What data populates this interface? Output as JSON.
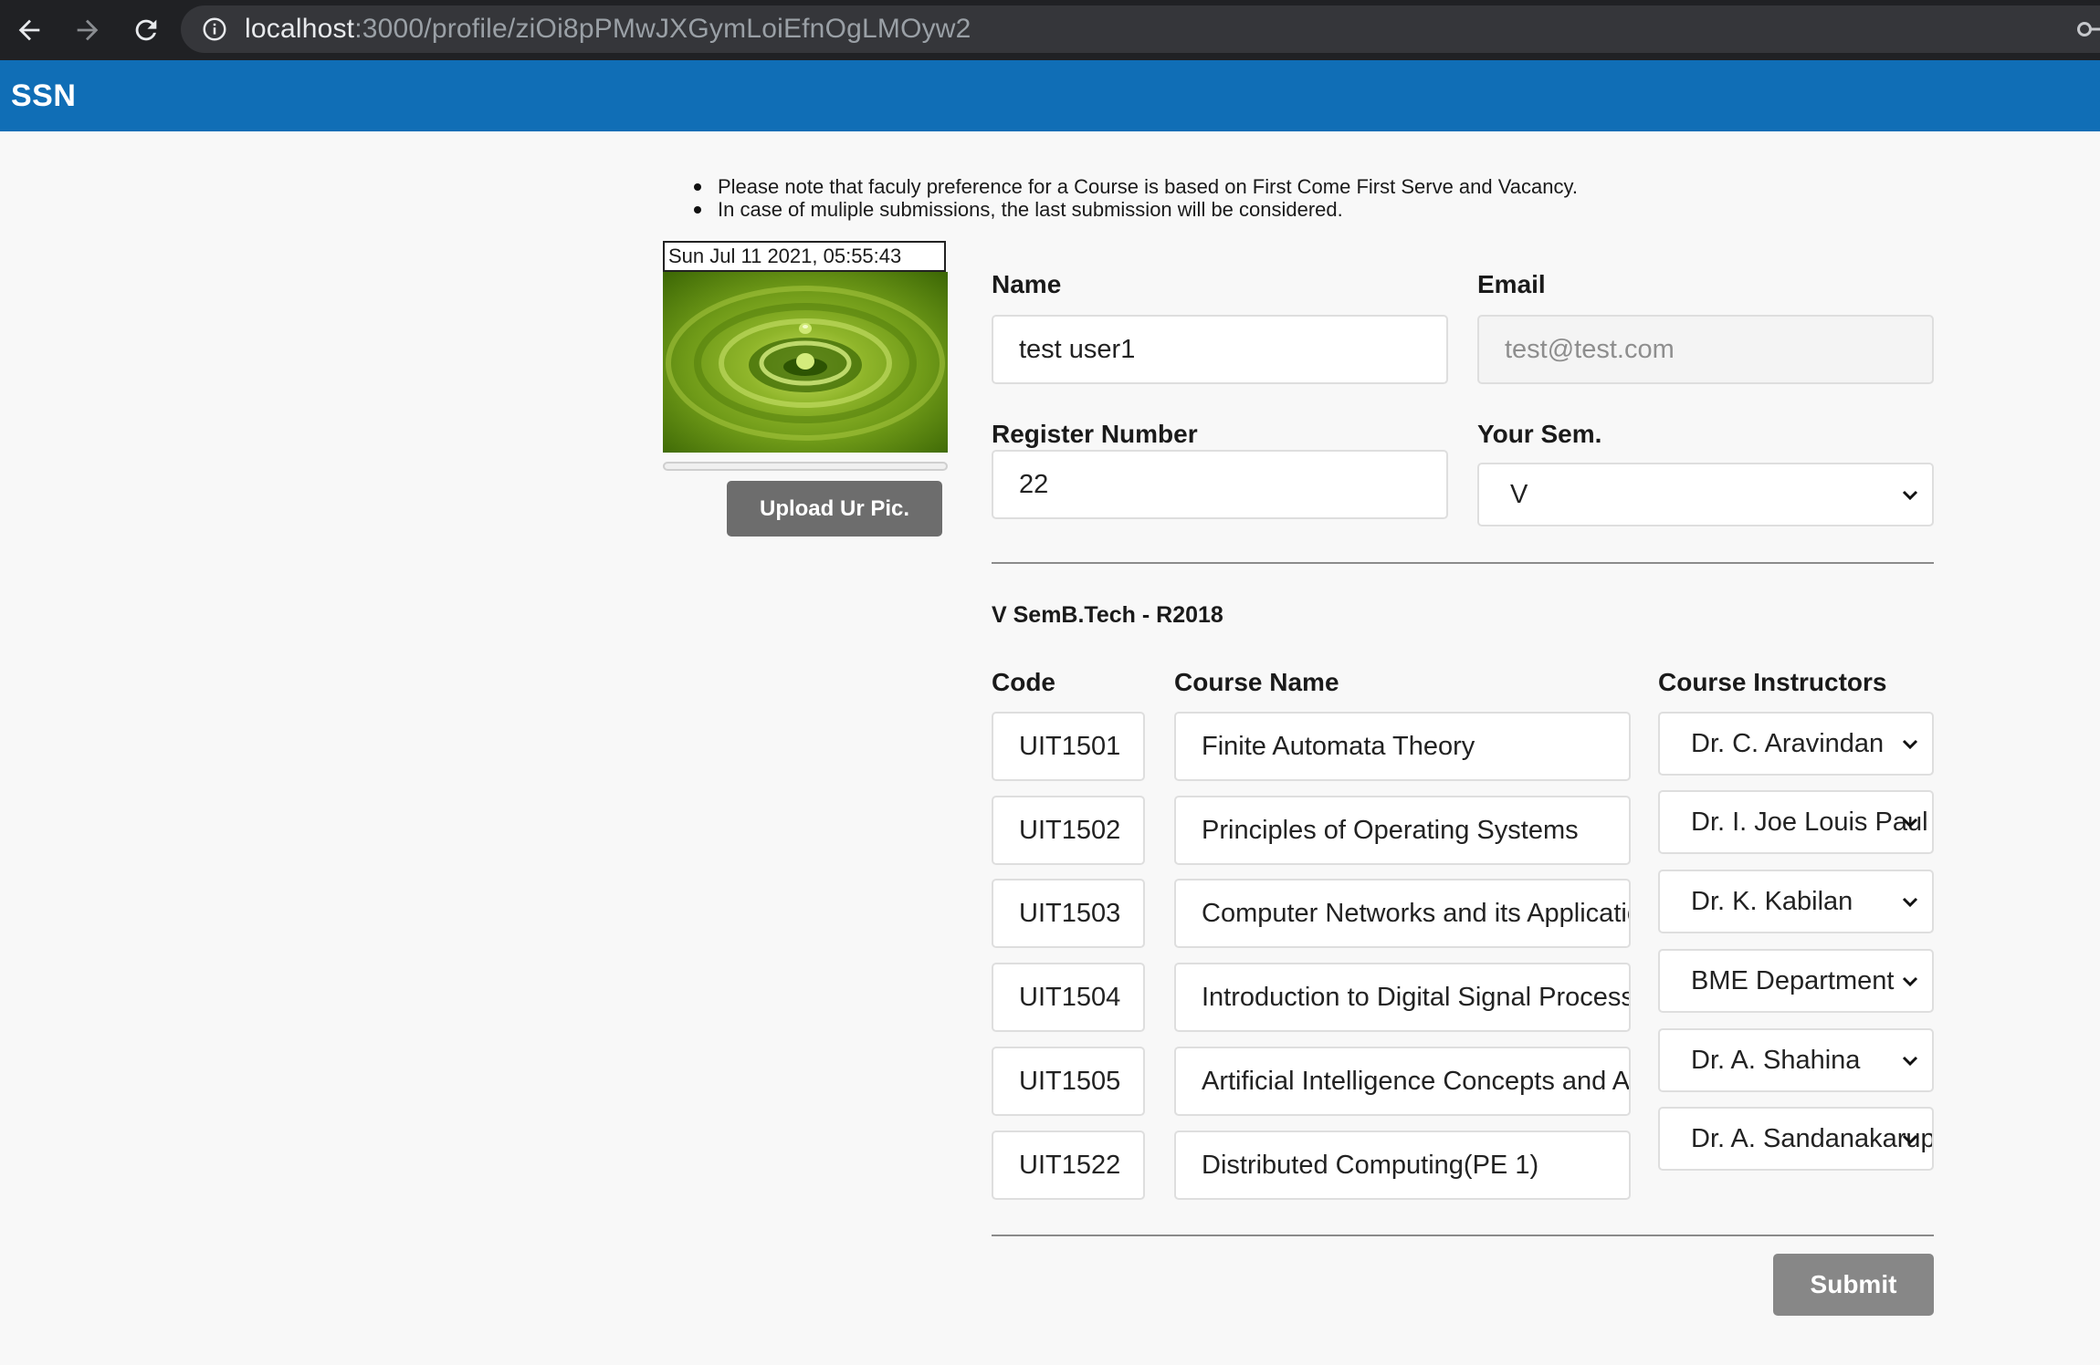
{
  "browser": {
    "url_host": "localhost",
    "url_path": ":3000/profile/ziOi8pPMwJXGymLoiEfnOgLMOyw2"
  },
  "app": {
    "brand": "SSN"
  },
  "notes": [
    "Please note that faculy preference for a Course is based on First Come First Serve and Vacancy.",
    "In case of muliple submissions, the last submission will be considered."
  ],
  "photo": {
    "timestamp": "Sun Jul 11 2021, 05:55:43",
    "upload_progress": 0,
    "upload_label": "Upload Ur Pic."
  },
  "form": {
    "name_label": "Name",
    "name_value": "test user1",
    "email_label": "Email",
    "email_value": "test@test.com",
    "register_label": "Register Number",
    "register_value": "22",
    "sem_label": "Your Sem.",
    "sem_value": "V"
  },
  "courses": {
    "section_title": "V SemB.Tech - R2018",
    "headers": {
      "code": "Code",
      "name": "Course Name",
      "instructors": "Course Instructors"
    },
    "rows": [
      {
        "code": "UIT1501",
        "name": "Finite Automata Theory",
        "instructor": "Dr. C. Aravindan"
      },
      {
        "code": "UIT1502",
        "name": "Principles of Operating Systems",
        "instructor": "Dr. I. Joe Louis Paul"
      },
      {
        "code": "UIT1503",
        "name": "Computer Networks and its Applications",
        "instructor": "Dr. K. Kabilan"
      },
      {
        "code": "UIT1504",
        "name": "Introduction to Digital Signal Processing",
        "instructor": "BME Department"
      },
      {
        "code": "UIT1505",
        "name": "Artificial Intelligence Concepts and Algorithms",
        "instructor": "Dr. A. Shahina"
      },
      {
        "code": "UIT1522",
        "name": "Distributed Computing(PE 1)",
        "instructor": "Dr. A. Sandanakaruppan"
      }
    ]
  },
  "submit_label": "Submit"
}
